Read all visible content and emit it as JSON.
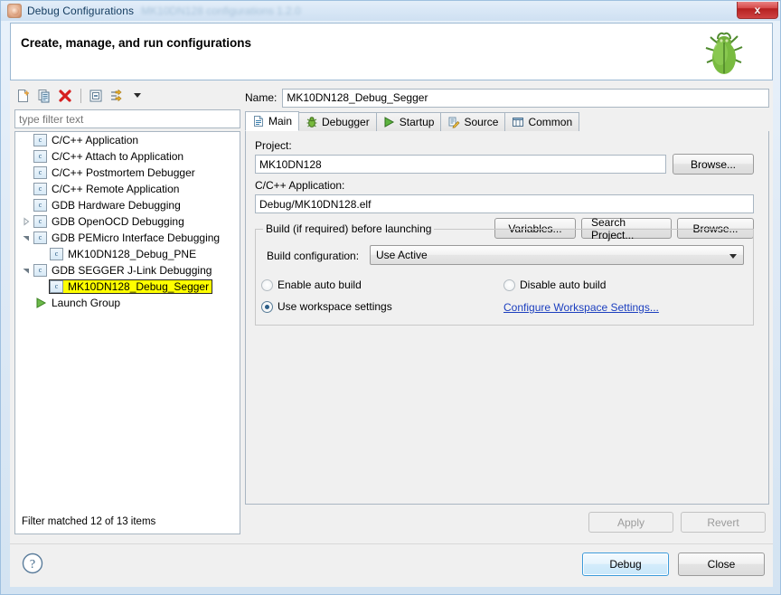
{
  "window": {
    "title": "Debug Configurations",
    "ghost_title": "MK10DN128 configurations 1.2.0",
    "icon": "bug-config-icon",
    "close_label": "x"
  },
  "header": {
    "title": "Create, manage, and run configurations",
    "icon": "green-bug-icon"
  },
  "toolbar": {
    "buttons": [
      {
        "name": "new-launch-configuration-icon",
        "label": ""
      },
      {
        "name": "duplicate-icon",
        "label": ""
      },
      {
        "name": "delete-icon",
        "label": ""
      },
      {
        "name": "collapse-all-icon",
        "label": ""
      },
      {
        "name": "filter-icon",
        "label": ""
      },
      {
        "name": "view-menu-caret-icon",
        "label": ""
      }
    ]
  },
  "filter": {
    "placeholder": "type filter text",
    "value": "",
    "status": "Filter matched 12 of 13 items"
  },
  "tree": {
    "items": [
      {
        "label": "C/C++ Application",
        "indent": 1,
        "arrow": "none",
        "icon": "c-config-icon",
        "selected": false
      },
      {
        "label": "C/C++ Attach to Application",
        "indent": 1,
        "arrow": "none",
        "icon": "c-config-icon",
        "selected": false
      },
      {
        "label": "C/C++ Postmortem Debugger",
        "indent": 1,
        "arrow": "none",
        "icon": "c-config-icon",
        "selected": false
      },
      {
        "label": "C/C++ Remote Application",
        "indent": 1,
        "arrow": "none",
        "icon": "c-config-icon",
        "selected": false
      },
      {
        "label": "GDB Hardware Debugging",
        "indent": 1,
        "arrow": "none",
        "icon": "c-config-icon",
        "selected": false
      },
      {
        "label": "GDB OpenOCD Debugging",
        "indent": 1,
        "arrow": "collapsed",
        "icon": "c-config-icon",
        "selected": false
      },
      {
        "label": "GDB PEMicro Interface Debugging",
        "indent": 1,
        "arrow": "expanded",
        "icon": "c-config-icon",
        "selected": false
      },
      {
        "label": "MK10DN128_Debug_PNE",
        "indent": 2,
        "arrow": "none",
        "icon": "c-config-icon",
        "selected": false
      },
      {
        "label": "GDB SEGGER J-Link Debugging",
        "indent": 1,
        "arrow": "expanded",
        "icon": "c-config-icon",
        "selected": false
      },
      {
        "label": "MK10DN128_Debug_Segger",
        "indent": 2,
        "arrow": "none",
        "icon": "c-config-icon",
        "selected": true
      },
      {
        "label": "Launch Group",
        "indent": 1,
        "arrow": "none",
        "icon": "launch-group-icon",
        "selected": false
      }
    ]
  },
  "details": {
    "name_label": "Name:",
    "name_value": "MK10DN128_Debug_Segger",
    "tabs": [
      {
        "label": "Main",
        "icon": "document-icon",
        "active": true
      },
      {
        "label": "Debugger",
        "icon": "bug-icon",
        "active": false
      },
      {
        "label": "Startup",
        "icon": "run-icon",
        "active": false
      },
      {
        "label": "Source",
        "icon": "source-icon",
        "active": false
      },
      {
        "label": "Common",
        "icon": "common-icon",
        "active": false
      }
    ],
    "project_label": "Project:",
    "project_value": "MK10DN128",
    "project_browse_label": "Browse...",
    "application_label": "C/C++ Application:",
    "application_value": "Debug/MK10DN128.elf",
    "application_buttons": [
      "Variables...",
      "Search Project...",
      "Browse..."
    ],
    "build_group_title": "Build (if required) before launching",
    "build_config_label": "Build configuration:",
    "build_config_value": "Use Active",
    "build_config_options": [
      "Use Active"
    ],
    "radio_enable_auto_build": "Enable auto build",
    "radio_disable_auto_build": "Disable auto build",
    "radio_use_workspace_settings": "Use workspace settings",
    "configure_workspace_link": "Configure Workspace Settings...",
    "selected_radio": "use_workspace_settings"
  },
  "actions": {
    "apply_label": "Apply",
    "revert_label": "Revert",
    "apply_enabled": false,
    "revert_enabled": false,
    "debug_label": "Debug",
    "close_label": "Close",
    "help_icon": "help-question-icon"
  },
  "colors": {
    "selection_highlight": "#ffff00",
    "link": "#1c3fbf",
    "primary_button_border": "#3c9bdb",
    "close_button": "#b52020"
  }
}
